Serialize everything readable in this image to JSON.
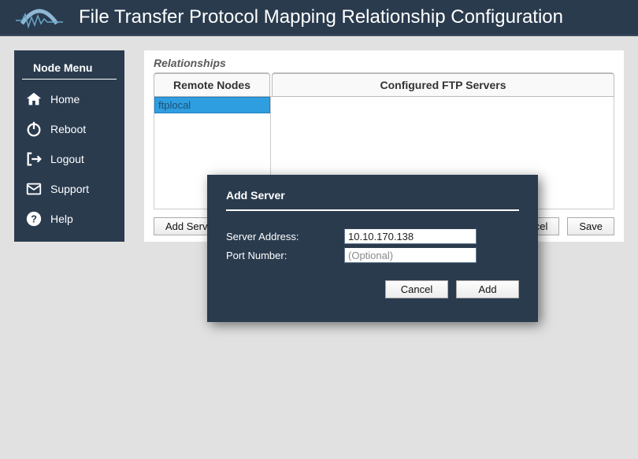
{
  "header": {
    "title": "File Transfer Protocol Mapping Relationship Configuration"
  },
  "sidebar": {
    "title": "Node Menu",
    "items": [
      {
        "label": "Home"
      },
      {
        "label": "Reboot"
      },
      {
        "label": "Logout"
      },
      {
        "label": "Support"
      },
      {
        "label": "Help"
      }
    ]
  },
  "panel": {
    "title": "Relationships",
    "remote_header": "Remote Nodes",
    "configured_header": "Configured FTP Servers",
    "remote_nodes": [
      {
        "name": "ftplocal"
      }
    ]
  },
  "footer": {
    "add_server": "Add Server",
    "cancel": "Cancel",
    "save": "Save"
  },
  "modal": {
    "title": "Add Server",
    "server_label": "Server Address:",
    "server_value": "10.10.170.138",
    "port_label": "Port Number:",
    "port_placeholder": "(Optional)",
    "port_value": "",
    "cancel": "Cancel",
    "add": "Add"
  }
}
